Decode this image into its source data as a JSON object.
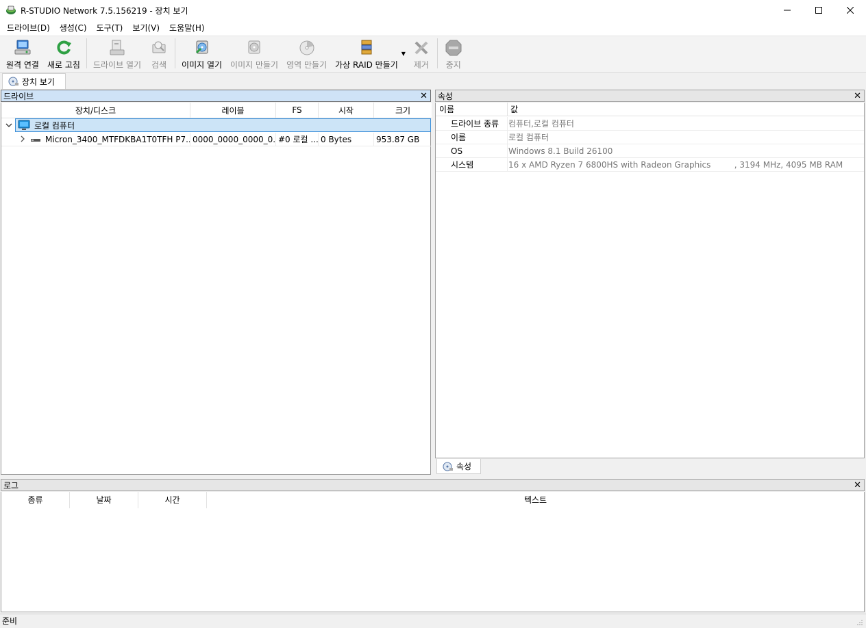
{
  "window": {
    "title": "R-STUDIO Network 7.5.156219 - 장치 보기"
  },
  "menu": [
    {
      "label": "드라이브(D)"
    },
    {
      "label": "생성(C)"
    },
    {
      "label": "도구(T)"
    },
    {
      "label": "보기(V)"
    },
    {
      "label": "도움말(H)"
    }
  ],
  "toolbar": {
    "remote_connect": "원격 연결",
    "refresh": "새로 고침",
    "open_drive": "드라이브 열기",
    "search": "검색",
    "open_image": "이미지 열기",
    "create_image": "이미지 만들기",
    "create_region": "영역 만들기",
    "create_virtual_raid": "가상 RAID 만들기",
    "remove": "제거",
    "stop": "중지"
  },
  "tabs": {
    "device_view": "장치 보기"
  },
  "drives_panel": {
    "title": "드라이브",
    "columns": [
      "장치/디스크",
      "레이블",
      "FS",
      "시작",
      "크기"
    ],
    "root": {
      "label": "로컬 컴퓨터"
    },
    "rows": [
      {
        "device": "Micron_3400_MTFDKBA1T0TFH P7...",
        "label": "0000_0000_0000_0...",
        "fs": "#0 로컬 ...",
        "start": "0 Bytes",
        "size": "953.87 GB"
      }
    ]
  },
  "props_panel": {
    "title": "속성",
    "col_name": "이름",
    "col_value": "값",
    "rows": [
      {
        "name": "드라이브 종류",
        "value": "컴퓨터,로컬 컴퓨터"
      },
      {
        "name": "이름",
        "value": "로컬 컴퓨터"
      },
      {
        "name": "OS",
        "value": "Windows 8.1 Build 26100"
      },
      {
        "name": "시스템",
        "value": "16 x AMD Ryzen 7 6800HS with Radeon Graphics         , 3194 MHz, 4095 MB RAM"
      }
    ],
    "tab": "속성"
  },
  "log_panel": {
    "title": "로그",
    "columns": [
      "종류",
      "날짜",
      "시간",
      "텍스트"
    ]
  },
  "status": {
    "text": "준비"
  },
  "colors": {
    "selection": "#cce4f7",
    "selection_border": "#3c8fd8",
    "active_header": "#cfe3f7"
  }
}
